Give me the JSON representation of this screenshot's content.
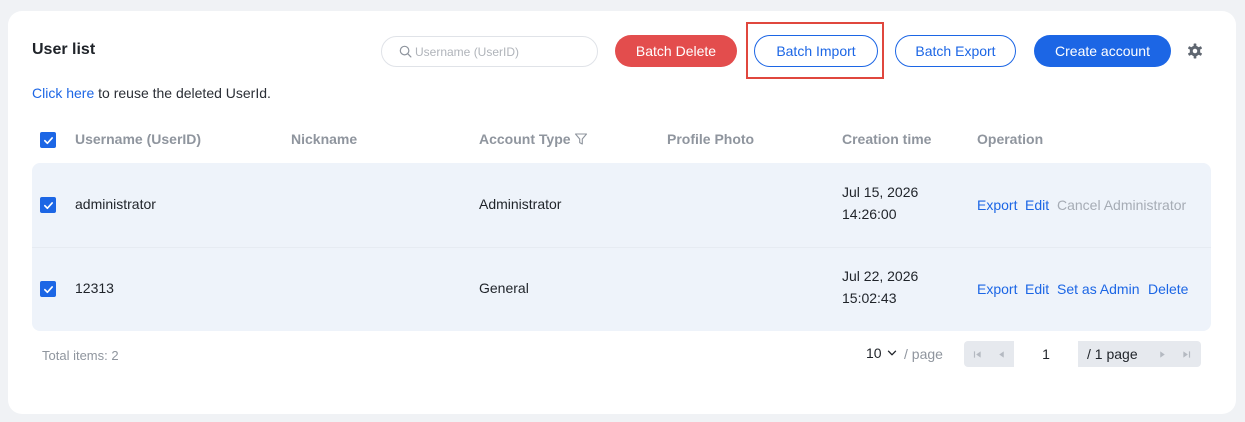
{
  "header": {
    "title": "User list",
    "search_placeholder": "Username (UserID)",
    "batch_delete_label": "Batch Delete",
    "batch_import_label": "Batch Import",
    "batch_export_label": "Batch Export",
    "create_account_label": "Create account",
    "settings_icon": "gear-icon"
  },
  "hint": {
    "link_text": "Click here",
    "rest_text": " to reuse the deleted UserId."
  },
  "table": {
    "columns": [
      "Username (UserID)",
      "Nickname",
      "Account Type",
      "Profile Photo",
      "Creation time",
      "Operation"
    ],
    "filter_icon": "filter-icon",
    "rows": [
      {
        "checked": true,
        "username": "administrator",
        "nickname": "",
        "account_type": "Administrator",
        "profile_photo": "",
        "creation_date": "Jul 15, 2026",
        "creation_clock": "14:26:00",
        "operations": [
          "Export",
          "Edit",
          "Cancel Administrator"
        ]
      },
      {
        "checked": true,
        "username": "12313",
        "nickname": "",
        "account_type": "General",
        "profile_photo": "",
        "creation_date": "Jul 22, 2026",
        "creation_clock": "15:02:43",
        "operations": [
          "Export",
          "Edit",
          "Set as Admin",
          "Delete"
        ]
      }
    ]
  },
  "footer": {
    "total_label": "Total items:",
    "total_count": "2",
    "page_size": "10",
    "per_page_label": "/ page",
    "current_page": "1",
    "total_pages_label": "/ 1 page"
  },
  "colors": {
    "primary": "#1c66e5",
    "danger": "#e34d4d",
    "highlight_box": "#e0473e",
    "row_bg": "#eef3fa"
  }
}
